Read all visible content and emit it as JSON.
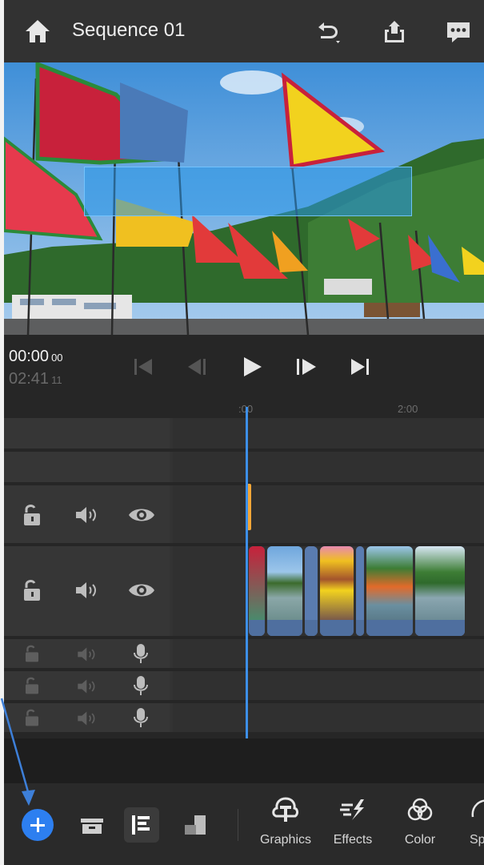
{
  "app": {
    "sequence_title": "Sequence 01"
  },
  "header": {
    "icons": [
      "home-icon",
      "undo-icon",
      "share-icon",
      "feedback-icon"
    ]
  },
  "transport": {
    "current_time": "00:00",
    "current_frames": "00",
    "duration_time": "02:41",
    "duration_frames": "11",
    "buttons": [
      "skip-to-start",
      "step-back",
      "play",
      "step-forward",
      "skip-to-end"
    ]
  },
  "ruler": {
    "marks": [
      ":00",
      "2:00"
    ]
  },
  "tracks": {
    "video": [
      {
        "name": "video-track-upper",
        "icons": [
          "lock-icon",
          "audio-icon",
          "visibility-icon"
        ]
      },
      {
        "name": "video-track-main",
        "icons": [
          "lock-icon",
          "audio-icon",
          "visibility-icon"
        ]
      }
    ],
    "audio": [
      {
        "name": "audio-track-1",
        "icons": [
          "lock-icon",
          "audio-icon",
          "mic-icon"
        ]
      },
      {
        "name": "audio-track-2",
        "icons": [
          "lock-icon",
          "audio-icon",
          "mic-icon"
        ]
      },
      {
        "name": "audio-track-3",
        "icons": [
          "lock-icon",
          "audio-icon",
          "mic-icon"
        ]
      }
    ]
  },
  "bottombar": {
    "left_icons": [
      "add-media-icon",
      "archive-icon",
      "timeline-list-icon",
      "layers-icon"
    ],
    "tools": [
      {
        "label": "Graphics",
        "icon": "graphics-icon"
      },
      {
        "label": "Effects",
        "icon": "effects-icon"
      },
      {
        "label": "Color",
        "icon": "color-icon"
      },
      {
        "label": "Sp",
        "icon": "speed-icon"
      }
    ]
  },
  "colors": {
    "accent": "#2d7ff0",
    "playhead": "#3d8fe8",
    "marker": "#f3a738",
    "clip": "#5a7cb0"
  }
}
